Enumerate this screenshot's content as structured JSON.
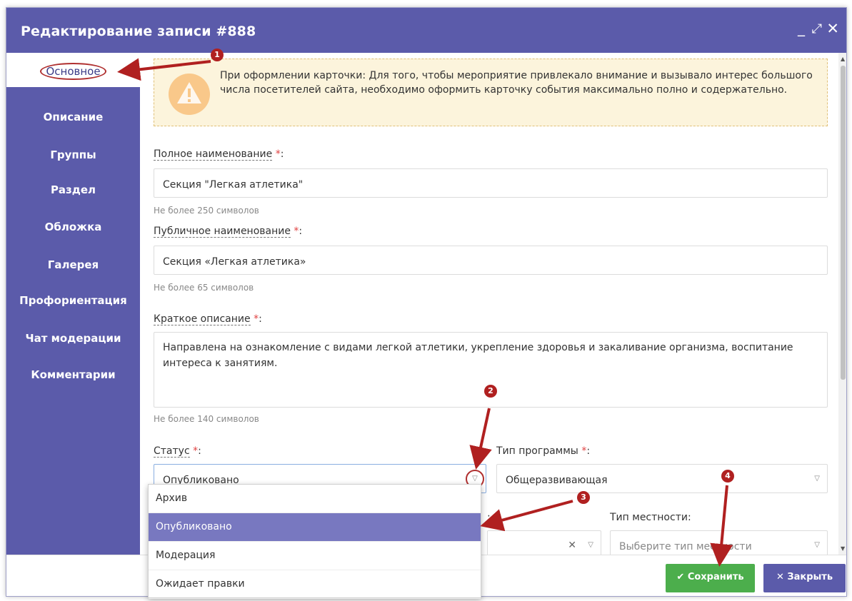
{
  "window": {
    "title": "Редактирование записи #888",
    "min_icon": "_",
    "max_icon": "⤢",
    "close_icon": "✕"
  },
  "sidebar": {
    "items": [
      {
        "label": "Основное",
        "active": true
      },
      {
        "label": "Описание"
      },
      {
        "label": "Группы"
      },
      {
        "label": "Раздел"
      },
      {
        "label": "Обложка"
      },
      {
        "label": "Галерея"
      },
      {
        "label": "Профориентация"
      },
      {
        "label": "Чат модерации"
      },
      {
        "label": "Комментарии"
      }
    ]
  },
  "alert": {
    "icon": "warning-icon",
    "text": "При оформлении карточки: Для того, чтобы мероприятие привлекало внимание и вызывало интерес большого числа посетителей сайта, необходимо оформить карточку события максимально полно и содержательно."
  },
  "form": {
    "full_name": {
      "label": "Полное наименование",
      "req": "*",
      "value": "Секция \"Легкая атлетика\"",
      "hint": "Не более 250 символов"
    },
    "public_name": {
      "label": "Публичное наименование",
      "req": "*",
      "value": "Секция «Легкая атлетика»",
      "hint": "Не более 65 символов"
    },
    "short_desc": {
      "label": "Краткое описание",
      "req": "*",
      "value": "Направлена на ознакомление с видами легкой атлетики, укрепление здоровья и закаливание организма, воспитание интереса к занятиям.",
      "hint": "Не более 140 символов"
    },
    "status": {
      "label": "Статус",
      "req": "*",
      "value": "Опубликовано",
      "options": [
        "Архив",
        "Опубликовано",
        "Модерация",
        "Ожидает правки"
      ]
    },
    "program_type": {
      "label": "Тип программы",
      "req": "*",
      "value": "Общеразвивающая"
    },
    "hidden_select": {
      "label_tail": ":",
      "clear": "✕"
    },
    "locality_type": {
      "label": "Тип местности:",
      "placeholder": "Выберите тип местности"
    }
  },
  "footer": {
    "save": "Сохранить",
    "save_icon": "✔",
    "close": "Закрыть",
    "close_icon": "✕"
  },
  "annotations": [
    "1",
    "2",
    "3",
    "4"
  ],
  "colors": {
    "header": "#5b5baa",
    "save": "#4cae4c",
    "selected_option": "#7878c0",
    "annotation": "#b02020",
    "alert_bg": "#fcf4dc"
  },
  "dropdown_caret": "▽",
  "colon": ":"
}
